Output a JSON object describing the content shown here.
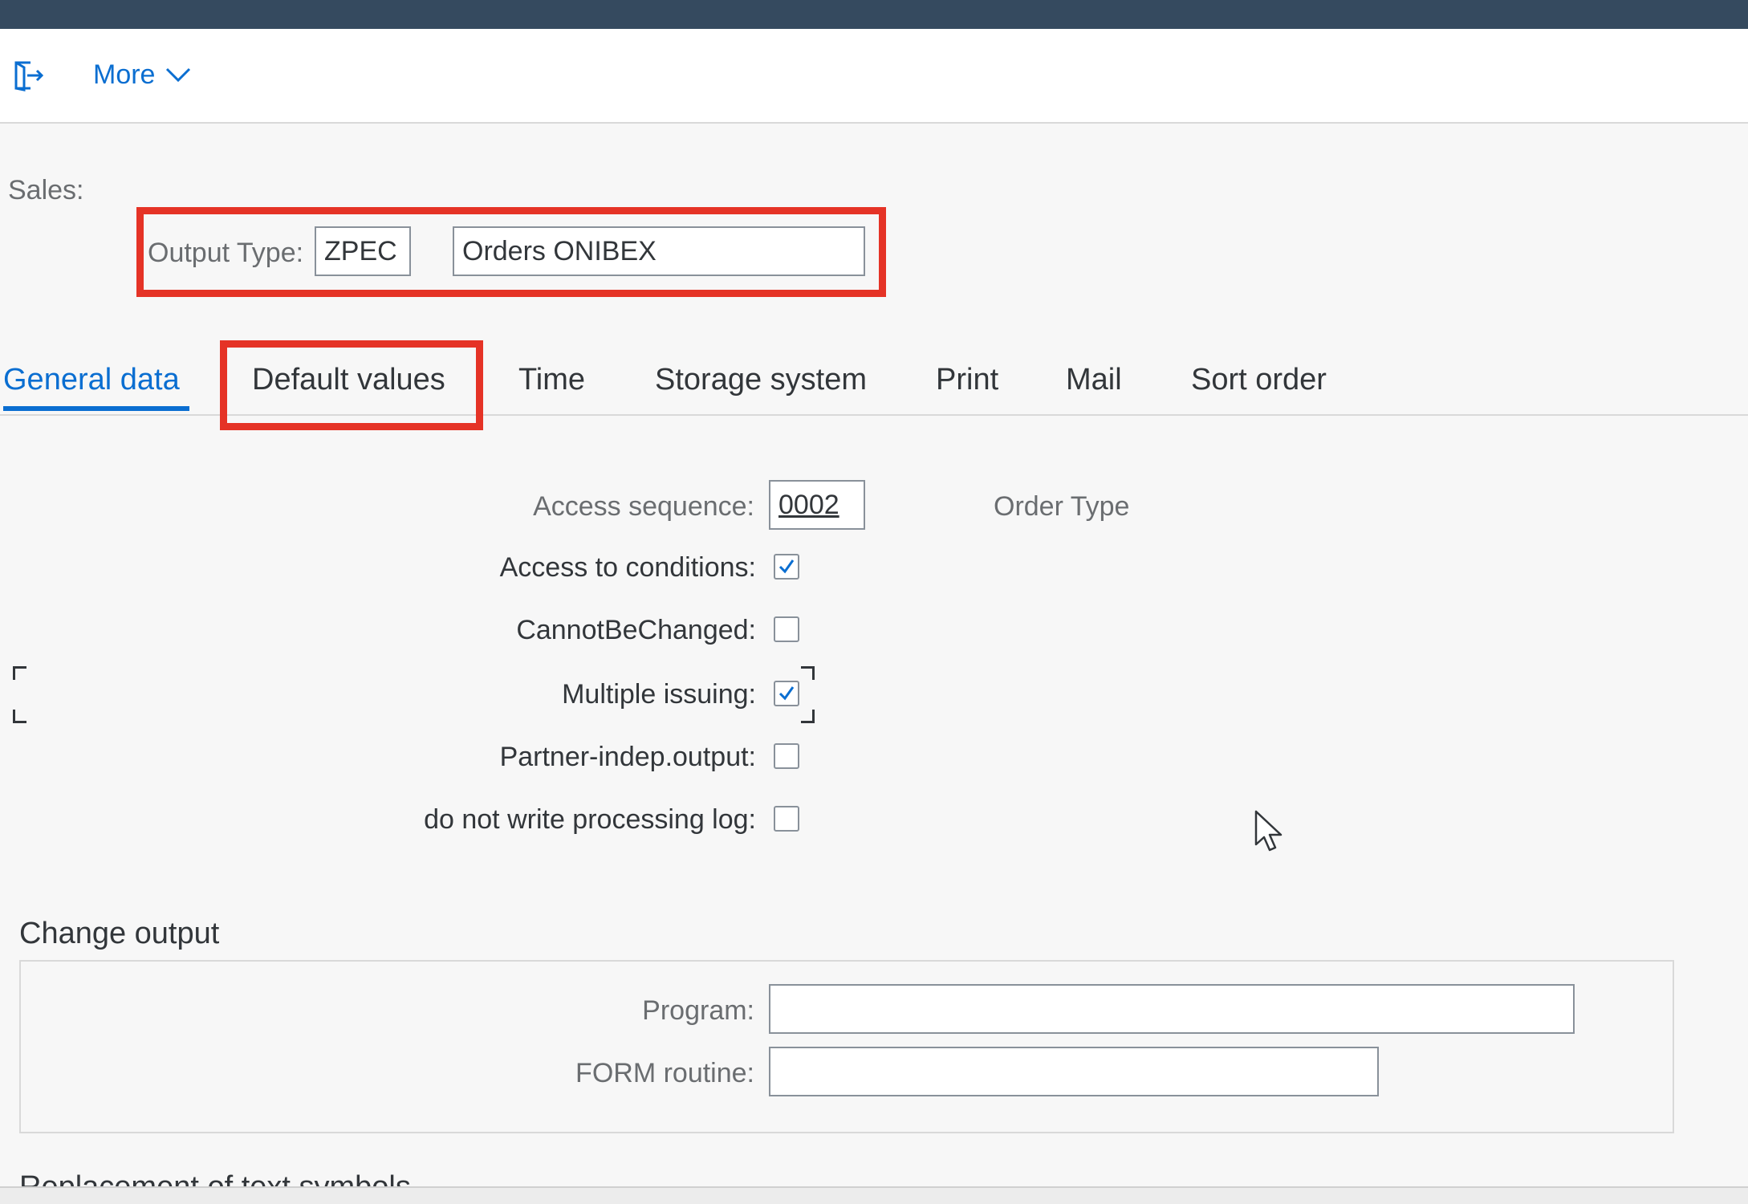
{
  "toolbar": {
    "exit_icon": "exit-icon",
    "more_label": "More",
    "more_icon": "chevron-down-icon"
  },
  "header": {
    "section_label": "Sales:",
    "output_type_label": "Output Type:",
    "output_type_code": "ZPEC",
    "output_type_name": "Orders ONIBEX"
  },
  "tabs": [
    {
      "label": "General data",
      "active": true
    },
    {
      "label": "Default values",
      "active": false
    },
    {
      "label": "Time",
      "active": false
    },
    {
      "label": "Storage system",
      "active": false
    },
    {
      "label": "Print",
      "active": false
    },
    {
      "label": "Mail",
      "active": false
    },
    {
      "label": "Sort order",
      "active": false
    }
  ],
  "general": {
    "access_sequence_label": "Access sequence:",
    "access_sequence_value": "0002",
    "access_sequence_desc": "Order Type",
    "checkboxes": [
      {
        "label": "Access to conditions:",
        "checked": true
      },
      {
        "label": "CannotBeChanged:",
        "checked": false
      },
      {
        "label": "Multiple issuing:",
        "checked": true
      },
      {
        "label": "Partner-indep.output:",
        "checked": false
      },
      {
        "label": "do not write processing log:",
        "checked": false
      }
    ]
  },
  "change_output": {
    "title": "Change output",
    "program_label": "Program:",
    "program_value": "",
    "form_routine_label": "FORM routine:",
    "form_routine_value": ""
  },
  "next_section": {
    "title": "Replacement of text symbols"
  },
  "colors": {
    "shell": "#354a5f",
    "accent": "#0a6ed1",
    "highlight": "#e53326"
  }
}
